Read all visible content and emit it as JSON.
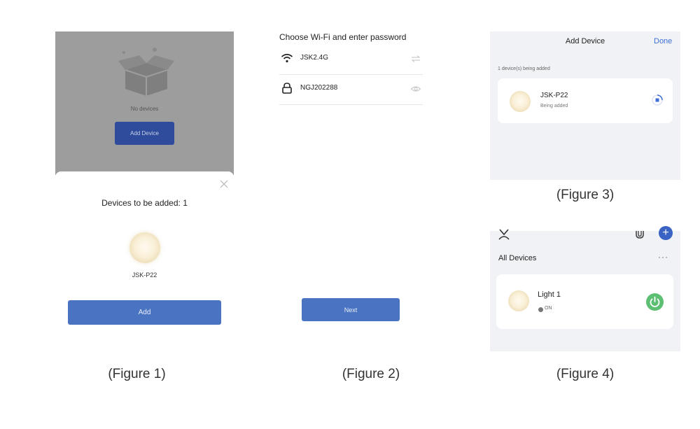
{
  "figure1": {
    "empty_state_text": "No devices",
    "add_device_label": "Add Device",
    "sheet_title": "Devices to be added: 1",
    "device_name": "JSK-P22",
    "add_button_label": "Add",
    "caption": "(Figure 1)",
    "icons": [
      "empty-box-icon",
      "close-icon",
      "bulb-icon"
    ]
  },
  "figure2": {
    "title": "Choose Wi-Fi and enter password",
    "wifi_ssid": "JSK2.4G",
    "password": "NGJ202288",
    "next_button_label": "Next",
    "caption": "(Figure 2)",
    "icons": [
      "wifi-icon",
      "switch-network-icon",
      "lock-icon",
      "eye-icon"
    ]
  },
  "figure3": {
    "title": "Add Device",
    "done_label": "Done",
    "subtitle": "1 device(s) being added",
    "device_name": "JSK-P22",
    "device_status": "Being added",
    "caption": "(Figure 3)",
    "icons": [
      "bulb-icon",
      "progress-icon"
    ]
  },
  "figure4": {
    "title": "All Devices",
    "more_label": "···",
    "device_name": "Light 1",
    "device_state": "ON",
    "caption": "(Figure 4)",
    "icons": [
      "user-icon",
      "mic-icon",
      "plus-icon",
      "bulb-icon",
      "power-icon"
    ],
    "colors": {
      "power_on": "#5cbf73",
      "accent": "#3b63c4"
    }
  },
  "colors": {
    "primary_button": "#4a73c2",
    "link": "#3d6fd6"
  }
}
